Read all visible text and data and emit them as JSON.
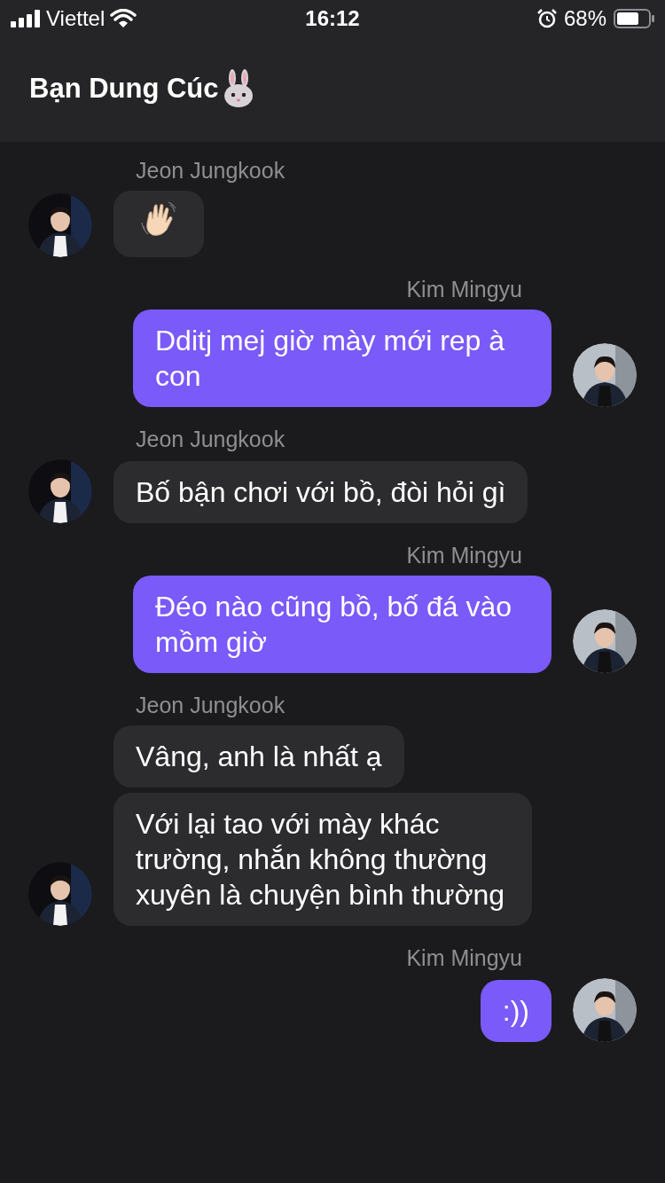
{
  "status_bar": {
    "carrier": "Viettel",
    "time": "16:12",
    "battery": "68%"
  },
  "header": {
    "title": "Bạn Dung Cúc"
  },
  "groups": [
    {
      "sender": "Jeon Jungkook",
      "outgoing": false,
      "messages": [
        {
          "kind": "wave"
        }
      ]
    },
    {
      "sender": "Kim Mingyu",
      "outgoing": true,
      "messages": [
        {
          "kind": "text",
          "text": "Dditj mej giờ mày mới rep à con"
        }
      ]
    },
    {
      "sender": "Jeon Jungkook",
      "outgoing": false,
      "messages": [
        {
          "kind": "text",
          "text": "Bố bận chơi với bồ, đòi hỏi gì"
        }
      ]
    },
    {
      "sender": "Kim Mingyu",
      "outgoing": true,
      "messages": [
        {
          "kind": "text",
          "text": "Đéo nào cũng bồ, bố đá vào mồm giờ"
        }
      ]
    },
    {
      "sender": "Jeon Jungkook",
      "outgoing": false,
      "messages": [
        {
          "kind": "text",
          "text": "Vâng, anh là nhất ạ"
        },
        {
          "kind": "text",
          "text": "Với lại tao với mày khác trường, nhắn không thường xuyên là chuyện bình thường"
        }
      ]
    },
    {
      "sender": "Kim Mingyu",
      "outgoing": true,
      "messages": [
        {
          "kind": "text",
          "text": ":))"
        }
      ]
    }
  ]
}
